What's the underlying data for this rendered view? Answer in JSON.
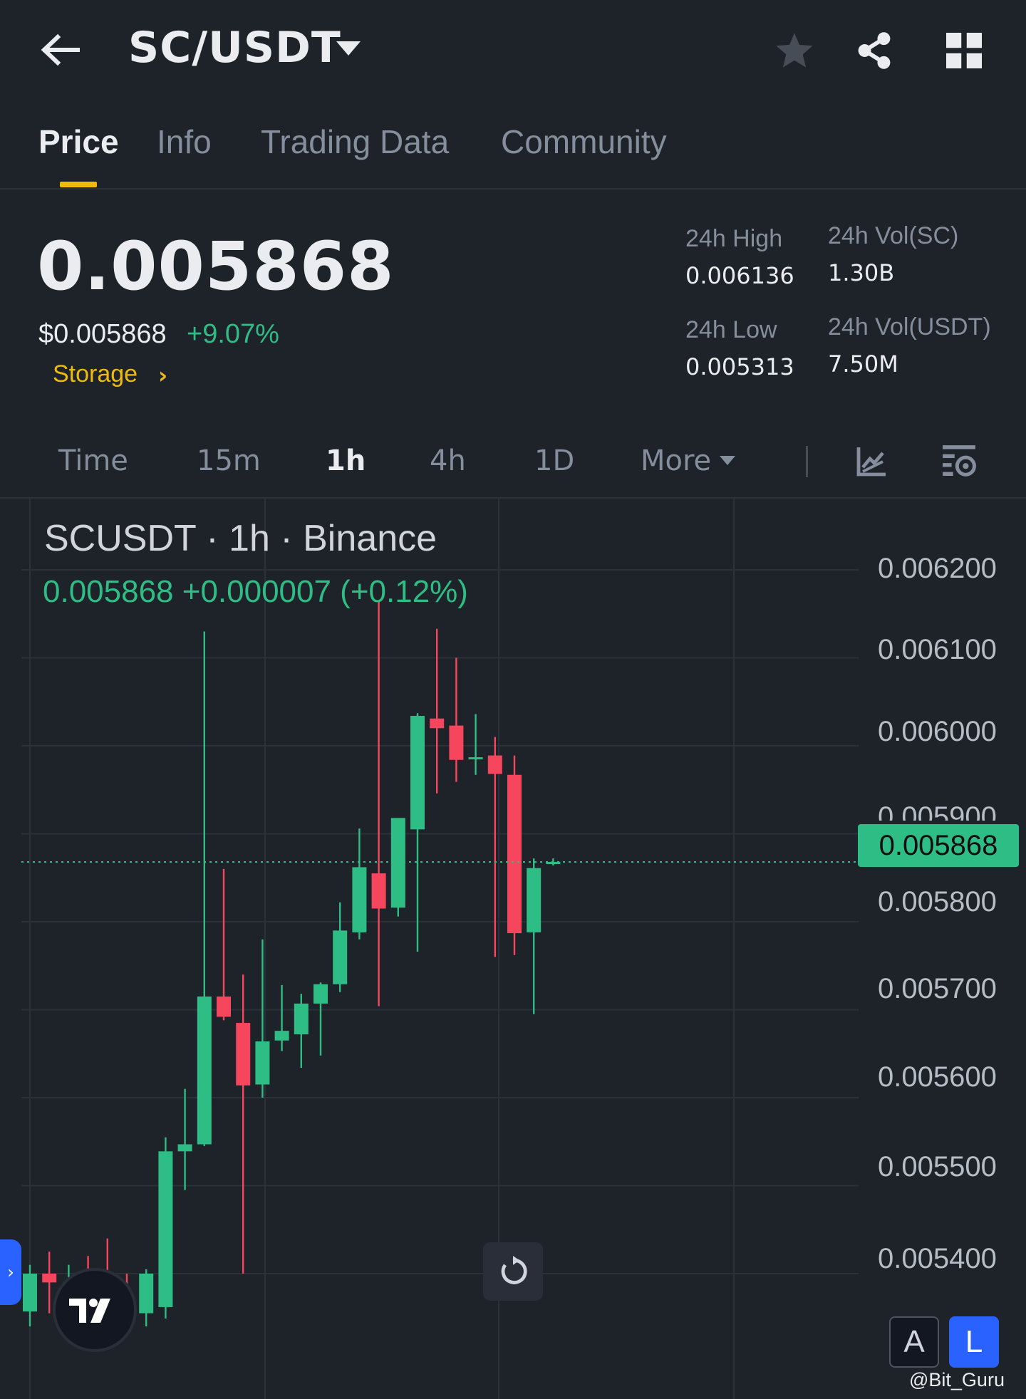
{
  "header": {
    "title": "SC/USDT",
    "icons": [
      "back-arrow-icon",
      "chevron-down-icon",
      "star-icon",
      "share-icon",
      "grid-icon"
    ]
  },
  "tabs": [
    {
      "label": "Price",
      "active": true
    },
    {
      "label": "Info",
      "active": false
    },
    {
      "label": "Trading Data",
      "active": false
    },
    {
      "label": "Community",
      "active": false
    }
  ],
  "price": {
    "last": "0.005868",
    "usd": "$0.005868",
    "change": "+9.07%",
    "tag": "Storage"
  },
  "stats": {
    "high_label": "24h High",
    "high_value": "0.006136",
    "low_label": "24h Low",
    "low_value": "0.005313",
    "vol_base_label": "24h Vol(SC)",
    "vol_base_value": "1.30B",
    "vol_quote_label": "24h Vol(USDT)",
    "vol_quote_value": "7.50M"
  },
  "intervals": {
    "items": [
      "Time",
      "15m",
      "1h",
      "4h",
      "1D",
      "More"
    ],
    "active": "1h"
  },
  "chart_header": {
    "title": "SCUSDT · 1h · Binance",
    "ohlc": "0.005868  +0.000007 (+0.12%)",
    "current_price": "0.005868",
    "scale_a": "A",
    "scale_l": "L"
  },
  "watermark": "@Bit_Guru",
  "colors": {
    "up": "#2ebd85",
    "down": "#f6465d",
    "accent": "#f0b90b",
    "background": "#1e2329"
  },
  "chart_data": {
    "type": "candlestick",
    "interval": "1h",
    "y_ticks": [
      "0.006200",
      "0.006100",
      "0.006000",
      "0.005900",
      "0.005800",
      "0.005700",
      "0.005600",
      "0.005500",
      "0.005400"
    ],
    "ylim": [
      0.005325,
      0.006215
    ],
    "current_price": 0.005868,
    "candles": [
      {
        "o": 0.005357,
        "h": 0.00541,
        "l": 0.00534,
        "c": 0.0054
      },
      {
        "o": 0.0054,
        "h": 0.005425,
        "l": 0.005355,
        "c": 0.00539
      },
      {
        "o": 0.005375,
        "h": 0.00541,
        "l": 0.00534,
        "c": 0.005385
      },
      {
        "o": 0.005395,
        "h": 0.00542,
        "l": 0.00535,
        "c": 0.005375
      },
      {
        "o": 0.005375,
        "h": 0.00544,
        "l": 0.005345,
        "c": 0.00536
      },
      {
        "o": 0.00535,
        "h": 0.0054,
        "l": 0.00533,
        "c": 0.005345
      },
      {
        "o": 0.005355,
        "h": 0.005405,
        "l": 0.00534,
        "c": 0.0054
      },
      {
        "o": 0.005362,
        "h": 0.005555,
        "l": 0.005349,
        "c": 0.005539
      },
      {
        "o": 0.005539,
        "h": 0.00561,
        "l": 0.005495,
        "c": 0.005547
      },
      {
        "o": 0.005547,
        "h": 0.00613,
        "l": 0.005545,
        "c": 0.005715
      },
      {
        "o": 0.005715,
        "h": 0.00586,
        "l": 0.005688,
        "c": 0.005692
      },
      {
        "o": 0.005685,
        "h": 0.00574,
        "l": 0.0054,
        "c": 0.005614
      },
      {
        "o": 0.005615,
        "h": 0.00578,
        "l": 0.0056,
        "c": 0.005664
      },
      {
        "o": 0.005665,
        "h": 0.005728,
        "l": 0.005653,
        "c": 0.005676
      },
      {
        "o": 0.005672,
        "h": 0.005718,
        "l": 0.005634,
        "c": 0.005707
      },
      {
        "o": 0.005707,
        "h": 0.005731,
        "l": 0.005648,
        "c": 0.005729
      },
      {
        "o": 0.005729,
        "h": 0.005822,
        "l": 0.00572,
        "c": 0.00579
      },
      {
        "o": 0.005788,
        "h": 0.005906,
        "l": 0.00578,
        "c": 0.005862
      },
      {
        "o": 0.005855,
        "h": 0.006164,
        "l": 0.005704,
        "c": 0.005815
      },
      {
        "o": 0.005816,
        "h": 0.005911,
        "l": 0.005806,
        "c": 0.005918
      },
      {
        "o": 0.005905,
        "h": 0.006037,
        "l": 0.005766,
        "c": 0.006034
      },
      {
        "o": 0.006031,
        "h": 0.006133,
        "l": 0.005946,
        "c": 0.00602
      },
      {
        "o": 0.006023,
        "h": 0.0061,
        "l": 0.005959,
        "c": 0.005984
      },
      {
        "o": 0.005985,
        "h": 0.006036,
        "l": 0.005967,
        "c": 0.005987
      },
      {
        "o": 0.005989,
        "h": 0.00601,
        "l": 0.00576,
        "c": 0.005968
      },
      {
        "o": 0.005967,
        "h": 0.005989,
        "l": 0.005762,
        "c": 0.005787
      },
      {
        "o": 0.005788,
        "h": 0.005872,
        "l": 0.005695,
        "c": 0.005861
      },
      {
        "o": 0.005866,
        "h": 0.005872,
        "l": 0.005864,
        "c": 0.005868
      }
    ]
  }
}
